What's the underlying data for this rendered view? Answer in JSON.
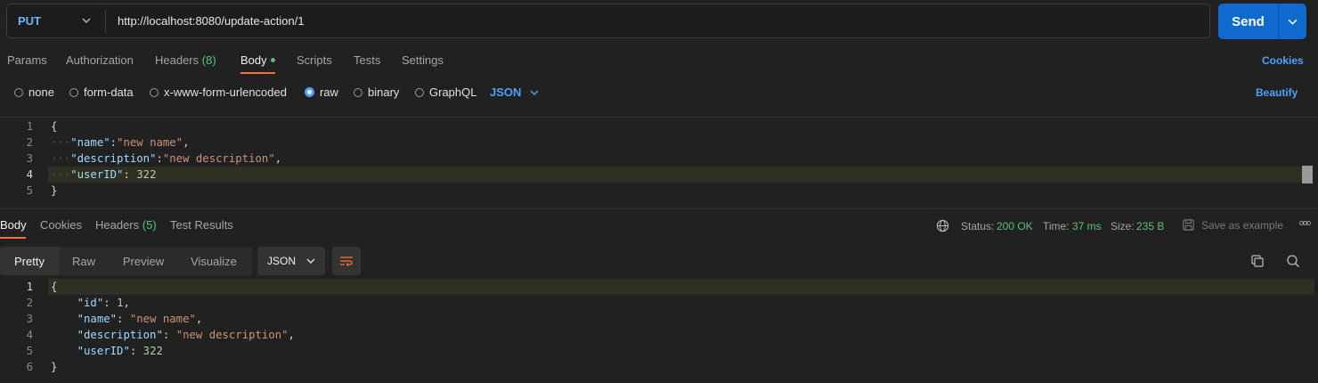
{
  "request": {
    "method": "PUT",
    "url": "http://localhost:8080/update-action/1",
    "send_label": "Send"
  },
  "request_tabs": {
    "params": "Params",
    "authorization": "Authorization",
    "headers": "Headers",
    "headers_count": "(8)",
    "body": "Body",
    "scripts": "Scripts",
    "tests": "Tests",
    "settings": "Settings",
    "cookies": "Cookies"
  },
  "body_types": {
    "none": "none",
    "form_data": "form-data",
    "urlencoded": "x-www-form-urlencoded",
    "raw": "raw",
    "binary": "binary",
    "graphql": "GraphQL",
    "format": "JSON",
    "selected": "raw",
    "beautify": "Beautify"
  },
  "request_body": {
    "line_numbers": [
      "1",
      "2",
      "3",
      "4",
      "5"
    ],
    "l1": "{",
    "name_key": "\"name\"",
    "name_val": "\"new name\"",
    "desc_key": "\"description\"",
    "desc_val": "\"new description\"",
    "user_key": "\"userID\"",
    "user_val": "322",
    "l5": "}"
  },
  "response_tabs": {
    "body": "Body",
    "cookies": "Cookies",
    "headers": "Headers",
    "headers_count": "(5)",
    "test_results": "Test Results"
  },
  "response_meta": {
    "status_label": "Status:",
    "status_value": "200 OK",
    "time_label": "Time:",
    "time_value": "37 ms",
    "size_label": "Size:",
    "size_value": "235 B",
    "save_example": "Save as example",
    "more": "ooo"
  },
  "response_view": {
    "pretty": "Pretty",
    "raw": "Raw",
    "preview": "Preview",
    "visualize": "Visualize",
    "format": "JSON"
  },
  "response_body": {
    "line_numbers": [
      "1",
      "2",
      "3",
      "4",
      "5",
      "6"
    ],
    "l1": "{",
    "id_key": "\"id\"",
    "id_val": "1",
    "name_key": "\"name\"",
    "name_val": "\"new name\"",
    "desc_key": "\"description\"",
    "desc_val": "\"new description\"",
    "user_key": "\"userID\"",
    "user_val": "322",
    "l6": "}"
  },
  "colors": {
    "accent": "#0f6ad0",
    "link": "#4ea0ff",
    "active_tab_underline": "#ff6c37",
    "status_ok": "#59c27a",
    "json_key": "#9cdcfe",
    "json_string": "#ce9178",
    "json_number": "#b5cea8"
  }
}
